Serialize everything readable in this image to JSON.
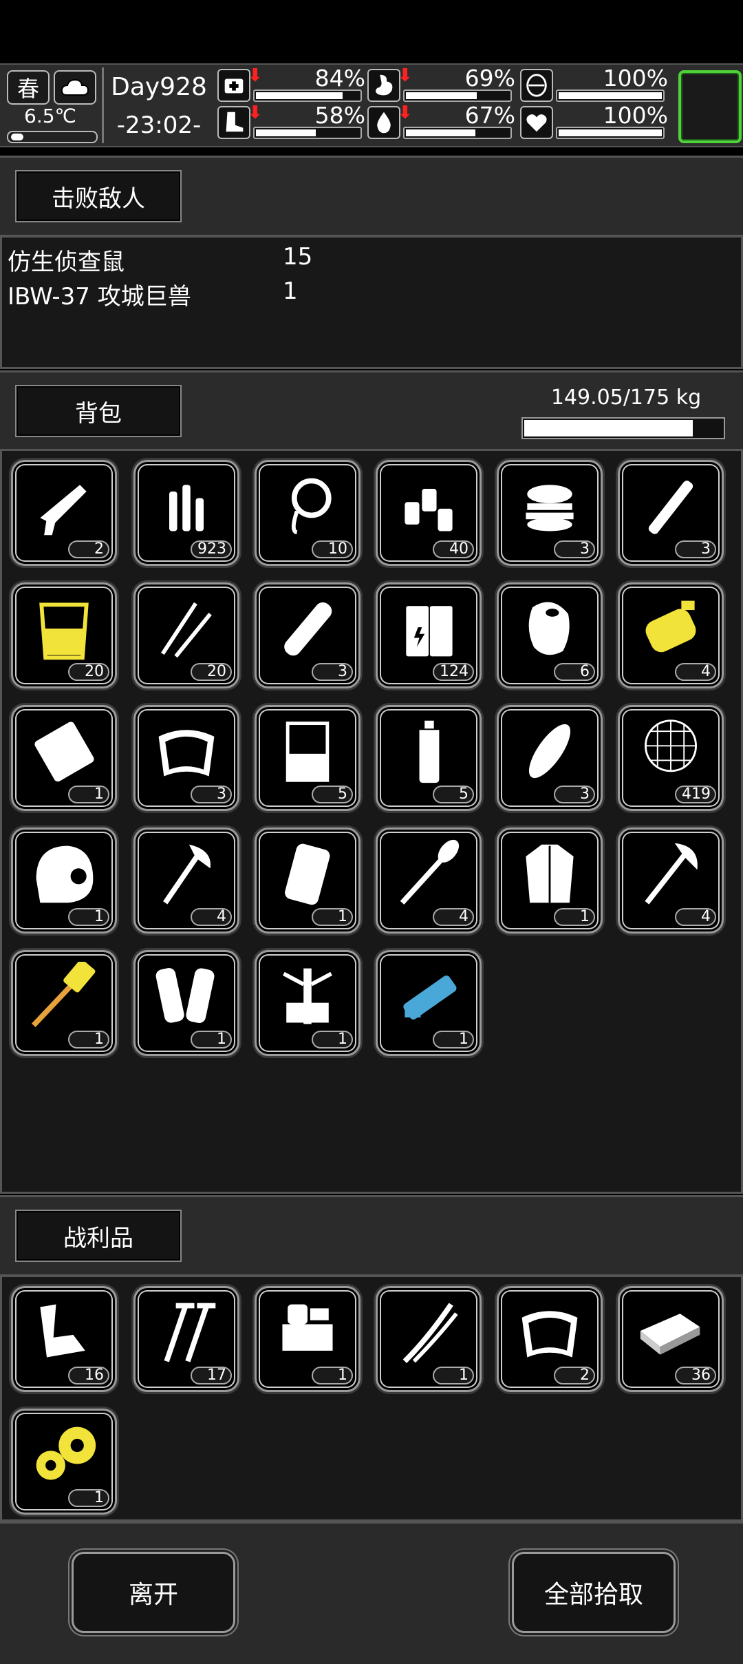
{
  "hud": {
    "season": "春",
    "weather_icon": "cloud-icon",
    "temperature": "6.5℃",
    "temperature_level": 0.15,
    "day": "Day928",
    "time": "-23:02-",
    "stats": [
      {
        "name": "health",
        "icon": "medkit-icon",
        "value": "84%",
        "level": 0.84,
        "falling": true
      },
      {
        "name": "hunger",
        "icon": "stomach-icon",
        "value": "69%",
        "level": 0.69,
        "falling": true
      },
      {
        "name": "mood",
        "icon": "brain-icon",
        "value": "100%",
        "level": 1.0,
        "falling": false
      },
      {
        "name": "stamina",
        "icon": "boot-icon",
        "value": "58%",
        "level": 0.58,
        "falling": true
      },
      {
        "name": "thirst",
        "icon": "water-drop-icon",
        "value": "67%",
        "level": 0.67,
        "falling": true
      },
      {
        "name": "heart",
        "icon": "heart-icon",
        "value": "100%",
        "level": 1.0,
        "falling": false
      }
    ]
  },
  "defeated": {
    "title": "击败敌人",
    "enemies": [
      {
        "name": "仿生侦查鼠",
        "count": "15"
      },
      {
        "name": "IBW-37 攻城巨兽",
        "count": "1"
      }
    ]
  },
  "backpack": {
    "title": "背包",
    "weight": "149.05/175 kg",
    "weight_level": 0.8517,
    "items": [
      {
        "icon": "caulking-gun-icon",
        "count": "2"
      },
      {
        "icon": "bullets-icon",
        "count": "923"
      },
      {
        "icon": "rope-icon",
        "count": "10"
      },
      {
        "icon": "bottles-icon",
        "count": "40"
      },
      {
        "icon": "burger-icon",
        "count": "3"
      },
      {
        "icon": "tube-icon",
        "count": "3"
      },
      {
        "icon": "glass-juice-icon",
        "count": "20"
      },
      {
        "icon": "lockpicks-icon",
        "count": "20"
      },
      {
        "icon": "bandage-roll-icon",
        "count": "3"
      },
      {
        "icon": "batteries-icon",
        "count": "124"
      },
      {
        "icon": "raw-meat-icon",
        "count": "6"
      },
      {
        "icon": "yellow-canister-icon",
        "count": "4"
      },
      {
        "icon": "plastic-bag-icon",
        "count": "1"
      },
      {
        "icon": "cloth-icon",
        "count": "3"
      },
      {
        "icon": "beaker-icon",
        "count": "5"
      },
      {
        "icon": "water-bottle-icon",
        "count": "5"
      },
      {
        "icon": "bread-icon",
        "count": "3"
      },
      {
        "icon": "net-icon",
        "count": "419"
      },
      {
        "icon": "helmet-icon",
        "count": "1"
      },
      {
        "icon": "axe-icon",
        "count": "4"
      },
      {
        "icon": "backpack-armor-icon",
        "count": "1"
      },
      {
        "icon": "shovel-icon",
        "count": "4"
      },
      {
        "icon": "coat-icon",
        "count": "1"
      },
      {
        "icon": "hatchet-icon",
        "count": "4"
      },
      {
        "icon": "golden-hammer-icon",
        "count": "1"
      },
      {
        "icon": "leg-armor-icon",
        "count": "1"
      },
      {
        "icon": "exoskeleton-icon",
        "count": "1"
      },
      {
        "icon": "blue-minigun-icon",
        "count": "1"
      }
    ]
  },
  "loot": {
    "title": "战利品",
    "items": [
      {
        "icon": "metal-scrap-icon",
        "count": "16"
      },
      {
        "icon": "screws-icon",
        "count": "17"
      },
      {
        "icon": "machine-parts-icon",
        "count": "1"
      },
      {
        "icon": "wires-icon",
        "count": "1"
      },
      {
        "icon": "cloth-icon",
        "count": "2"
      },
      {
        "icon": "metal-plate-icon",
        "count": "36"
      },
      {
        "icon": "gears-icon",
        "count": "1"
      }
    ]
  },
  "footer": {
    "leave": "离开",
    "take_all": "全部拾取"
  },
  "colors": {
    "accent_green": "#4fd13a",
    "alert_red": "#ff2020",
    "highlight_yellow": "#f2e33a",
    "highlight_blue": "#4aa8d8"
  }
}
